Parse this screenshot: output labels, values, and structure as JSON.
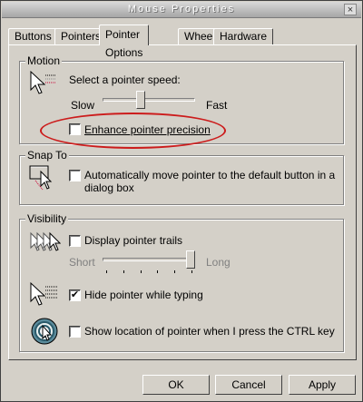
{
  "window": {
    "title": "Mouse Properties",
    "close_glyph": "×"
  },
  "tabs": [
    {
      "label": "Buttons"
    },
    {
      "label": "Pointers"
    },
    {
      "label": "Pointer Options"
    },
    {
      "label": "Wheel"
    },
    {
      "label": "Hardware"
    }
  ],
  "motion": {
    "title": "Motion",
    "speed_label": "Select a pointer speed:",
    "slow": "Slow",
    "fast": "Fast",
    "speed_value": 0.4,
    "precision_label": "Enhance pointer precision",
    "precision_checked": false,
    "icon": "pointer-speed-icon"
  },
  "snap": {
    "title": "Snap To",
    "label": "Automatically move pointer to the default button in a dialog box",
    "checked": false,
    "icon": "snap-to-icon"
  },
  "visibility": {
    "title": "Visibility",
    "trails_label": "Display pointer trails",
    "trails_checked": false,
    "short": "Short",
    "long": "Long",
    "trails_value": 1.0,
    "hide_label": "Hide pointer while typing",
    "hide_checked": true,
    "show_label": "Show location of pointer when I press the CTRL key",
    "show_checked": false,
    "icons": [
      "pointer-trails-icon",
      "hide-pointer-icon",
      "show-location-icon"
    ]
  },
  "buttons": {
    "ok": "OK",
    "cancel": "Cancel",
    "apply": "Apply"
  },
  "highlight_color": "#cc1c1c"
}
